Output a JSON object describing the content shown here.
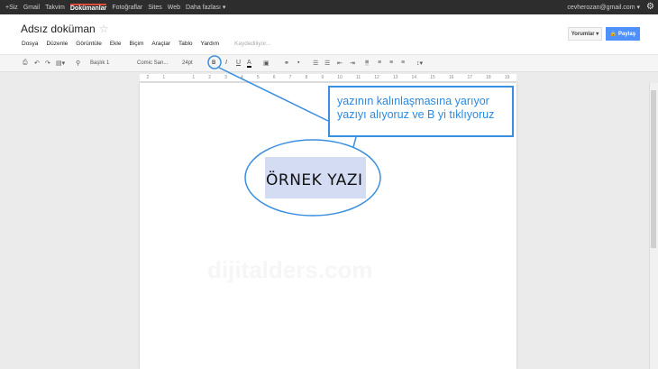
{
  "topbar": {
    "items": [
      "+Siz",
      "Gmail",
      "Takvim",
      "Dokümanlar",
      "Fotoğraflar",
      "Sites",
      "Web",
      "Daha fazlası ▾"
    ],
    "account": "cevherozan@gmail.com ▾"
  },
  "doc": {
    "title": "Adsız doküman",
    "menu": [
      "Dosya",
      "Düzenle",
      "Görüntüle",
      "Ekle",
      "Biçim",
      "Araçlar",
      "Tablo",
      "Yardım"
    ],
    "status": "Kaydediliyor..."
  },
  "buttons": {
    "comments": "Yorumlar ▾",
    "share": "🔒 Paylaş"
  },
  "toolbar": {
    "style": "Başlık 1",
    "font": "Comic San...",
    "size": "24pt",
    "bold": "B",
    "italic": "I",
    "underline": "U",
    "color": "A"
  },
  "ruler": [
    "2",
    "1",
    "",
    "1",
    "2",
    "3",
    "4",
    "5",
    "6",
    "7",
    "8",
    "9",
    "10",
    "11",
    "12",
    "13",
    "14",
    "15",
    "16",
    "17",
    "18",
    "19"
  ],
  "content": {
    "text": "ÖRNEK YAZI",
    "watermark": "dijitalders.com"
  },
  "annotation": {
    "line1": "yazının kalınlaşmasına yarıyor",
    "line2": "yazıyı alıyoruz ve B yi tıklıyoruz",
    "color": "#3b8fe0"
  }
}
